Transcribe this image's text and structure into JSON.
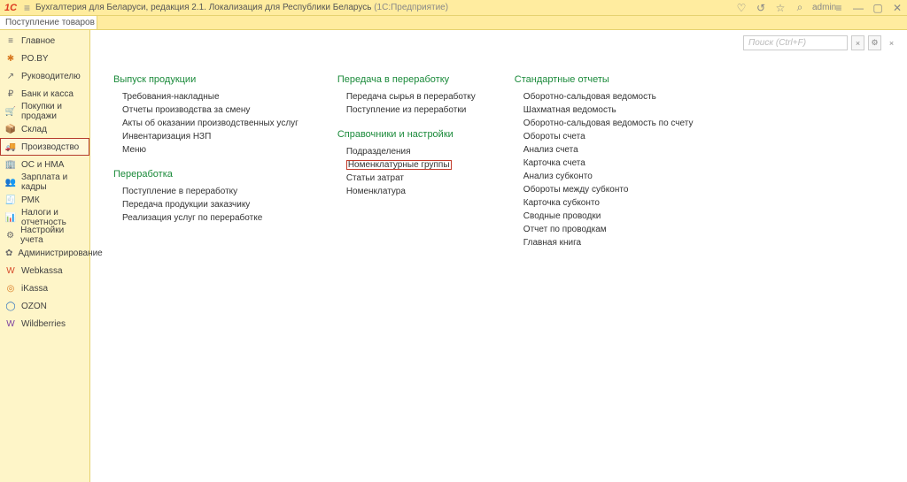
{
  "titlebar": {
    "app_title": "Бухгалтерия для Беларуси, редакция 2.1. Локализация для Республики Беларусь",
    "app_suffix": "(1С:Предприятие)",
    "user": "admin"
  },
  "tabs": [
    {
      "label": "Поступление товаров и услуг"
    }
  ],
  "sidebar": {
    "items": [
      {
        "id": "main",
        "label": "Главное",
        "icon": "≡",
        "icon_cls": ""
      },
      {
        "id": "poby",
        "label": "PO.BY",
        "icon": "✱",
        "icon_cls": "orange"
      },
      {
        "id": "leader",
        "label": "Руководителю",
        "icon": "↗",
        "icon_cls": ""
      },
      {
        "id": "bank",
        "label": "Банк и касса",
        "icon": "₽",
        "icon_cls": ""
      },
      {
        "id": "sales",
        "label": "Покупки и продажи",
        "icon": "🛒",
        "icon_cls": ""
      },
      {
        "id": "stock",
        "label": "Склад",
        "icon": "📦",
        "icon_cls": ""
      },
      {
        "id": "prod",
        "label": "Производство",
        "icon": "🚚",
        "icon_cls": "",
        "selected": true
      },
      {
        "id": "os",
        "label": "ОС и НМА",
        "icon": "🏢",
        "icon_cls": ""
      },
      {
        "id": "salary",
        "label": "Зарплата и кадры",
        "icon": "👥",
        "icon_cls": ""
      },
      {
        "id": "rmk",
        "label": "РМК",
        "icon": "🧾",
        "icon_cls": ""
      },
      {
        "id": "tax",
        "label": "Налоги и отчетность",
        "icon": "📊",
        "icon_cls": ""
      },
      {
        "id": "settings",
        "label": "Настройки учета",
        "icon": "⚙",
        "icon_cls": ""
      },
      {
        "id": "admin",
        "label": "Администрирование",
        "icon": "✿",
        "icon_cls": ""
      },
      {
        "id": "webkassa",
        "label": "Webkassa",
        "icon": "W",
        "icon_cls": "red"
      },
      {
        "id": "ikassa",
        "label": "iKassa",
        "icon": "◎",
        "icon_cls": "orange"
      },
      {
        "id": "ozon",
        "label": "OZON",
        "icon": "◯",
        "icon_cls": "blue"
      },
      {
        "id": "wb",
        "label": "Wildberries",
        "icon": "W",
        "icon_cls": "purple"
      }
    ]
  },
  "search": {
    "placeholder": "Поиск (Ctrl+F)"
  },
  "columns": [
    {
      "groups": [
        {
          "title": "Выпуск продукции",
          "links": [
            "Требования-накладные",
            "Отчеты производства за смену",
            "Акты об оказании производственных услуг",
            "Инвентаризация НЗП",
            "Меню"
          ]
        },
        {
          "title": "Переработка",
          "links": [
            "Поступление в переработку",
            "Передача продукции заказчику",
            "Реализация услуг по переработке"
          ]
        }
      ]
    },
    {
      "groups": [
        {
          "title": "Передача в переработку",
          "links": [
            "Передача сырья в переработку",
            "Поступление из переработки"
          ]
        },
        {
          "title": "Справочники и настройки",
          "links": [
            "Подразделения",
            "Номенклатурные группы",
            "Статьи затрат",
            "Номенклатура"
          ],
          "highlight_index": 1
        }
      ]
    },
    {
      "groups": [
        {
          "title": "Стандартные отчеты",
          "links": [
            "Оборотно-сальдовая ведомость",
            "Шахматная ведомость",
            "Оборотно-сальдовая ведомость по счету",
            "Обороты счета",
            "Анализ счета",
            "Карточка счета",
            "Анализ субконто",
            "Обороты между субконто",
            "Карточка субконто",
            "Сводные проводки",
            "Отчет по проводкам",
            "Главная книга"
          ]
        }
      ]
    }
  ]
}
